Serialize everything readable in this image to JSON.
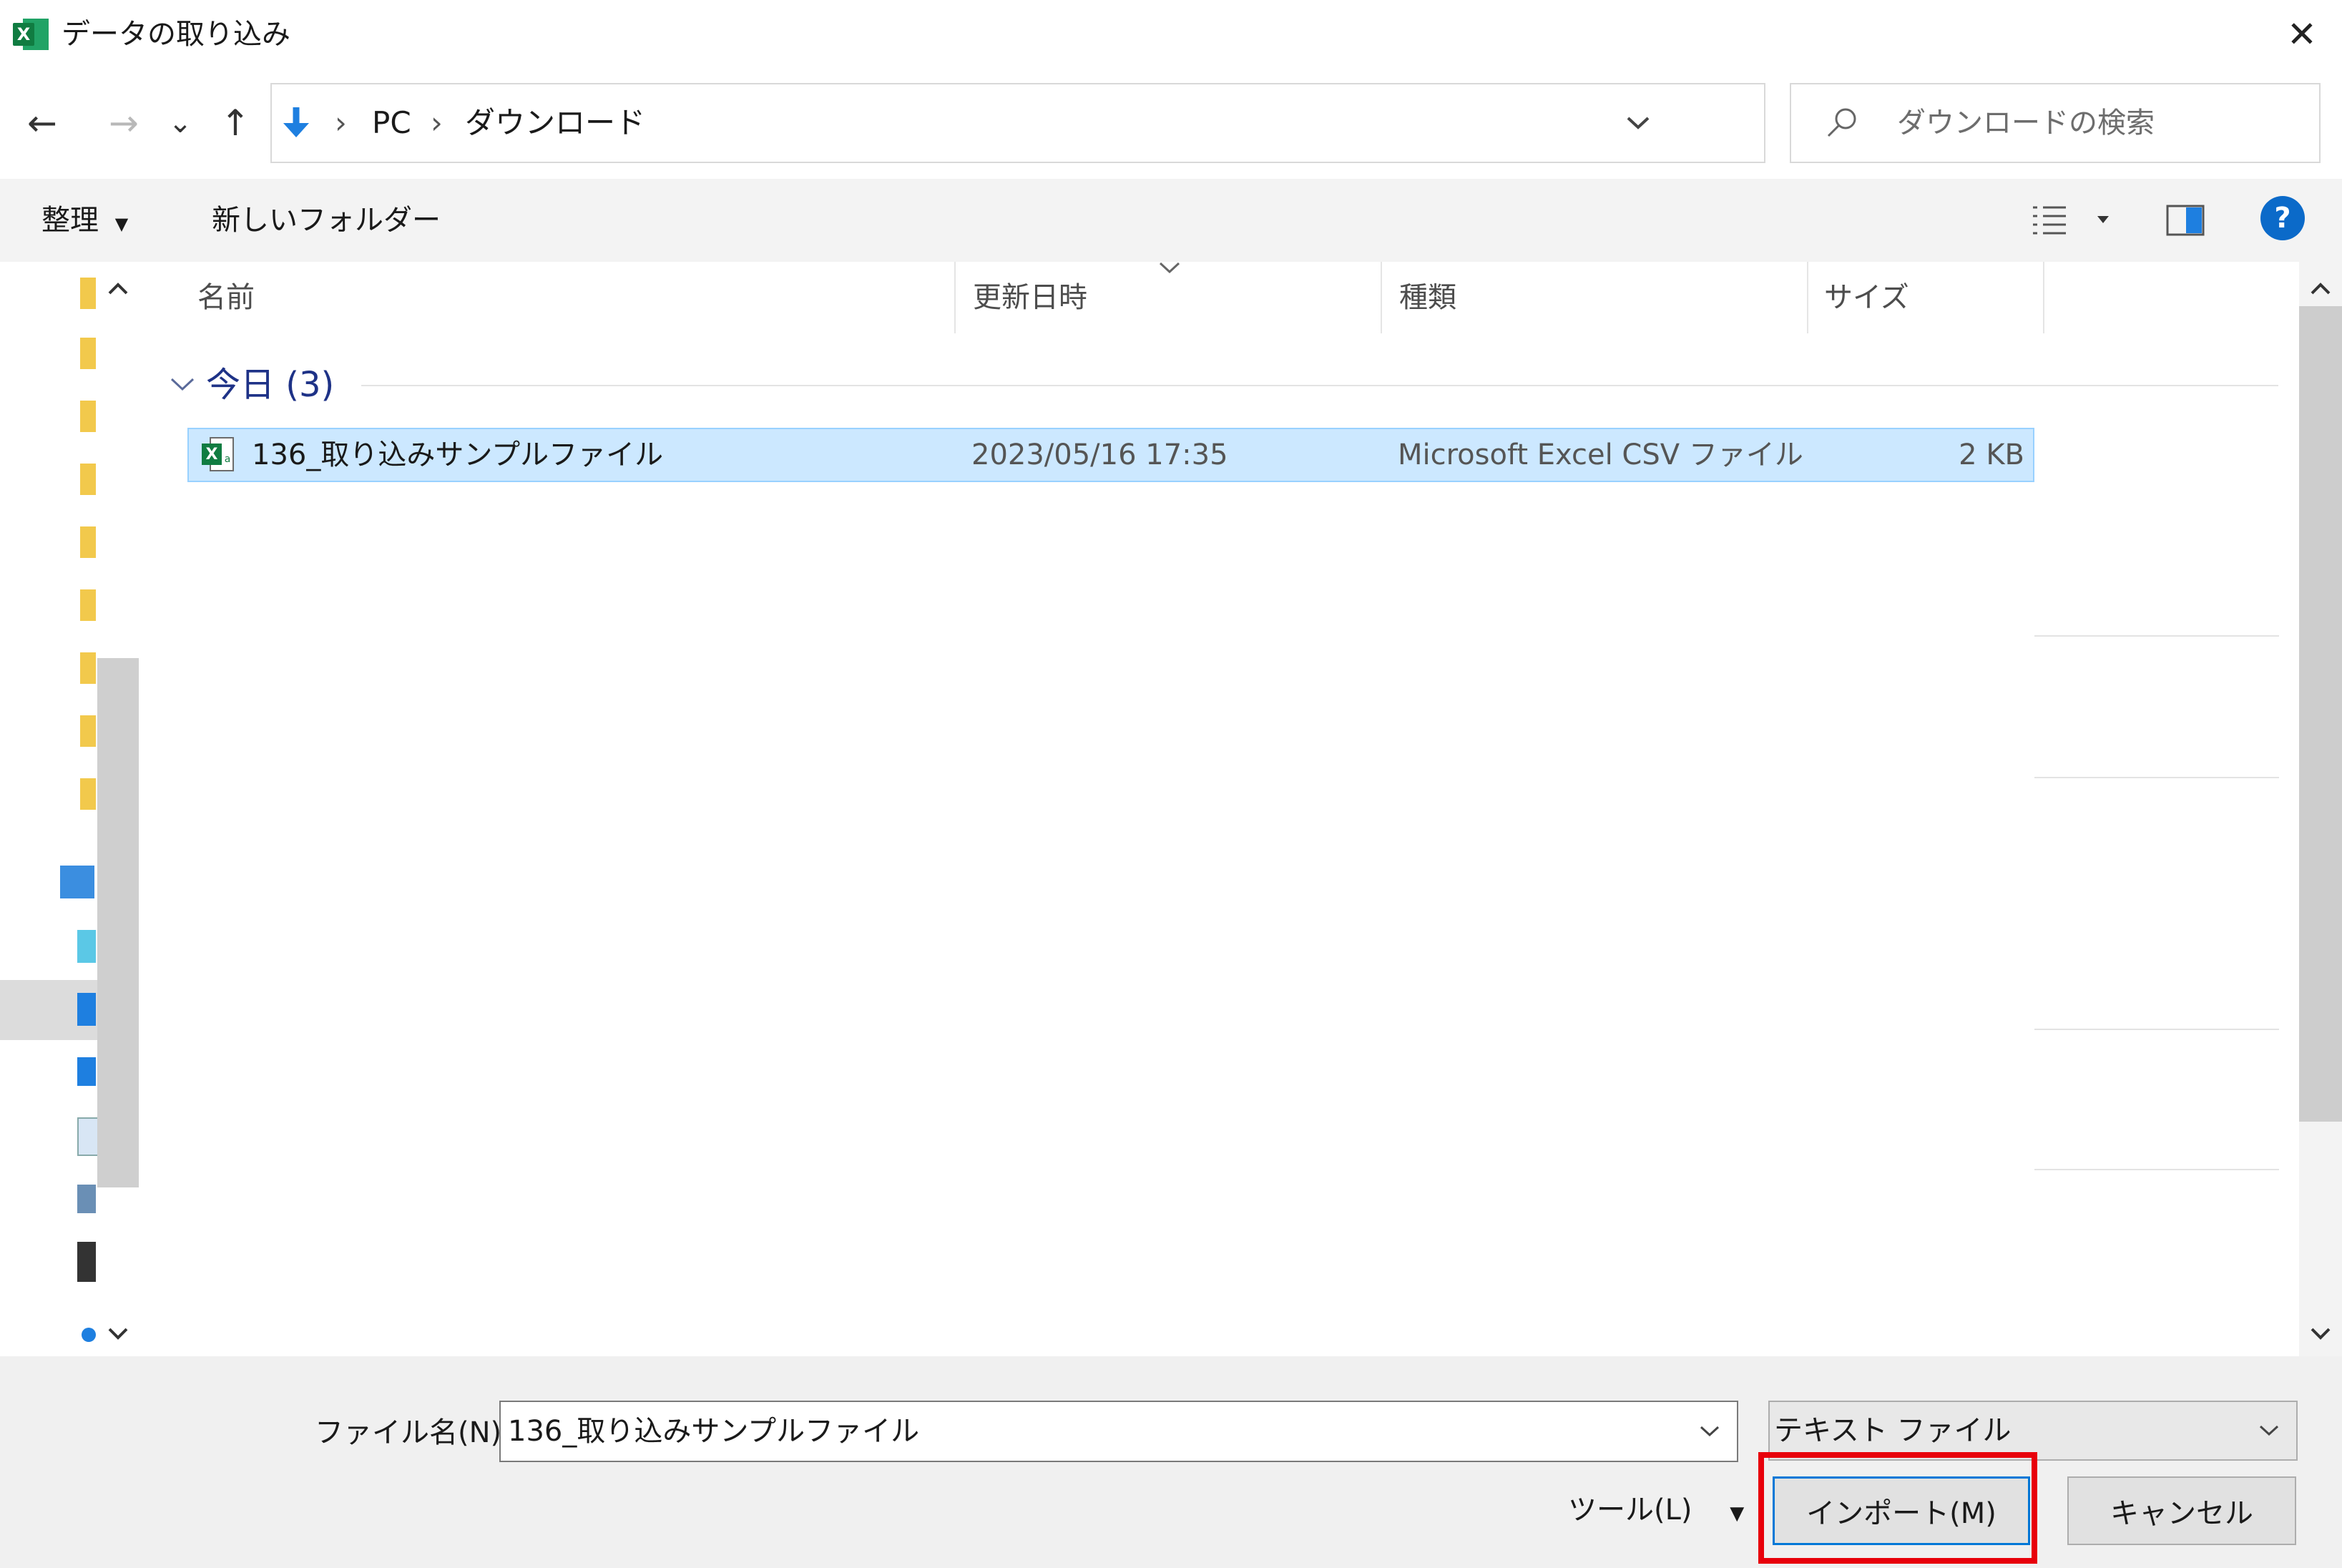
{
  "window": {
    "title": "データの取り込み",
    "close_glyph": "✕"
  },
  "nav": {
    "back_glyph": "←",
    "forward_glyph": "→",
    "recent_glyph": "⌄",
    "up_glyph": "↑",
    "breadcrumb": [
      "PC",
      "ダウンロード"
    ],
    "separator": "›",
    "refresh_glyph": "↻",
    "search_placeholder": "ダウンロードの検索"
  },
  "toolbar": {
    "organize_label": "整理",
    "new_folder_label": "新しいフォルダー",
    "help_glyph": "?"
  },
  "columns": [
    "名前",
    "更新日時",
    "種類",
    "サイズ"
  ],
  "group": {
    "label": "今日 (3)"
  },
  "files": [
    {
      "name": "136_取り込みサンプルファイル",
      "modified": "2023/05/16 17:35",
      "type": "Microsoft Excel CSV ファイル",
      "size": "2 KB"
    }
  ],
  "bottom": {
    "filename_label": "ファイル名(N):",
    "filename_value": "136_取り込みサンプルファイル",
    "filetype_value": "テキスト ファイル",
    "tools_label": "ツール(L)",
    "import_label": "インポート(M)",
    "cancel_label": "キャンセル"
  },
  "colors": {
    "accent": "#0078d7",
    "highlight_box": "#e8000b",
    "selection": "#cce8ff"
  }
}
